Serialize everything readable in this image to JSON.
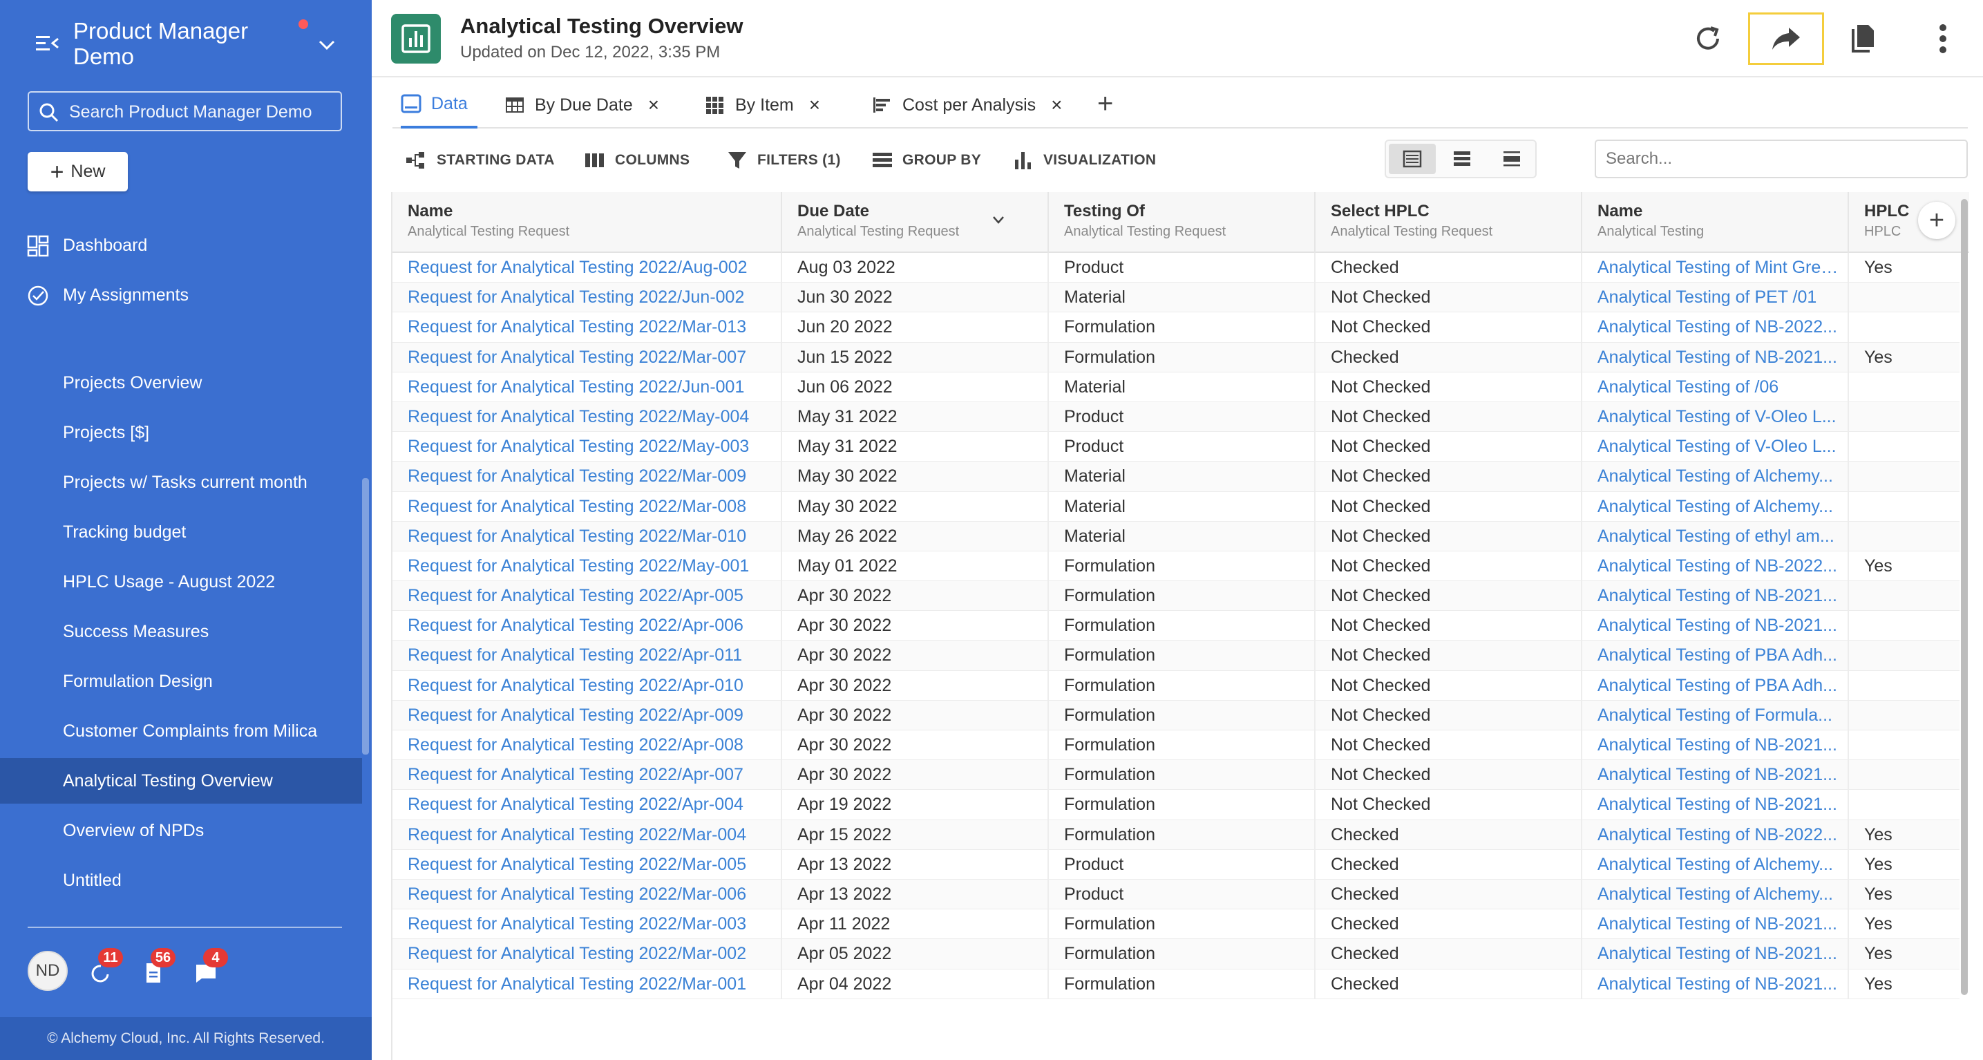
{
  "sidebar": {
    "title": "Product Manager Demo",
    "search_placeholder": "Search Product Manager Demo",
    "new_label": "New",
    "top_items": [
      {
        "label": "Dashboard",
        "icon": "dashboard-icon"
      },
      {
        "label": "My Assignments",
        "icon": "check-circle-icon"
      }
    ],
    "reports": [
      {
        "label": "Projects Overview"
      },
      {
        "label": "Projects [$]"
      },
      {
        "label": "Projects w/ Tasks current month"
      },
      {
        "label": "Tracking budget"
      },
      {
        "label": "HPLC Usage - August 2022"
      },
      {
        "label": "Success Measures"
      },
      {
        "label": "Formulation Design"
      },
      {
        "label": "Customer Complaints from Milica"
      },
      {
        "label": "Analytical Testing Overview",
        "active": true
      },
      {
        "label": "Overview of NPDs"
      },
      {
        "label": "Untitled"
      }
    ],
    "user_initials": "ND",
    "badges": {
      "activity": "11",
      "documents": "56",
      "messages": "4"
    },
    "footer": "© Alchemy Cloud, Inc. All Rights Reserved."
  },
  "header": {
    "title": "Analytical Testing Overview",
    "subtitle": "Updated on Dec 12, 2022, 3:35 PM",
    "accent_color": "#2e8b6b"
  },
  "tabs": [
    {
      "label": "Data",
      "icon": "table-icon",
      "active": true,
      "closable": false
    },
    {
      "label": "By Due Date",
      "icon": "grid-table-icon",
      "closable": true
    },
    {
      "label": "By Item",
      "icon": "pivot-icon",
      "closable": true
    },
    {
      "label": "Cost per Analysis",
      "icon": "bar-chart-horizontal-icon",
      "closable": true
    }
  ],
  "toolbar": {
    "starting_data": "STARTING DATA",
    "columns": "COLUMNS",
    "filters": "FILTERS (1)",
    "group_by": "GROUP BY",
    "visualization": "VISUALIZATION",
    "search_placeholder": "Search..."
  },
  "grid": {
    "columns": [
      {
        "title": "Name",
        "sub": "Analytical Testing Request"
      },
      {
        "title": "Due Date",
        "sub": "Analytical Testing Request"
      },
      {
        "title": "Testing Of",
        "sub": "Analytical Testing Request"
      },
      {
        "title": "Select HPLC",
        "sub": "Analytical Testing Request"
      },
      {
        "title": "Name",
        "sub": "Analytical Testing"
      },
      {
        "title": "HPLC",
        "sub": "HPLC"
      }
    ],
    "rows": [
      [
        "Request for Analytical Testing 2022/Aug-002",
        "Aug 03 2022",
        "Product",
        "Checked",
        "Analytical Testing of Mint Green...",
        "Yes"
      ],
      [
        "Request for Analytical Testing 2022/Jun-002",
        "Jun 30 2022",
        "Material",
        "Not Checked",
        "Analytical Testing of PET /01",
        ""
      ],
      [
        "Request for Analytical Testing 2022/Mar-013",
        "Jun 20 2022",
        "Formulation",
        "Not Checked",
        "Analytical Testing of NB-2022...",
        ""
      ],
      [
        "Request for Analytical Testing 2022/Mar-007",
        "Jun 15 2022",
        "Formulation",
        "Checked",
        "Analytical Testing of NB-2021...",
        "Yes"
      ],
      [
        "Request for Analytical Testing 2022/Jun-001",
        "Jun 06 2022",
        "Material",
        "Not Checked",
        "Analytical Testing of /06",
        ""
      ],
      [
        "Request for Analytical Testing 2022/May-004",
        "May 31 2022",
        "Product",
        "Not Checked",
        "Analytical Testing of V-Oleo L...",
        ""
      ],
      [
        "Request for Analytical Testing 2022/May-003",
        "May 31 2022",
        "Product",
        "Not Checked",
        "Analytical Testing of V-Oleo L...",
        ""
      ],
      [
        "Request for Analytical Testing 2022/Mar-009",
        "May 30 2022",
        "Material",
        "Not Checked",
        "Analytical Testing of Alchemy...",
        ""
      ],
      [
        "Request for Analytical Testing 2022/Mar-008",
        "May 30 2022",
        "Material",
        "Not Checked",
        "Analytical Testing of Alchemy...",
        ""
      ],
      [
        "Request for Analytical Testing 2022/Mar-010",
        "May 26 2022",
        "Material",
        "Not Checked",
        "Analytical Testing of ethyl am...",
        ""
      ],
      [
        "Request for Analytical Testing 2022/May-001",
        "May 01 2022",
        "Formulation",
        "Not Checked",
        "Analytical Testing of NB-2022...",
        "Yes"
      ],
      [
        "Request for Analytical Testing 2022/Apr-005",
        "Apr 30 2022",
        "Formulation",
        "Not Checked",
        "Analytical Testing of NB-2021...",
        ""
      ],
      [
        "Request for Analytical Testing 2022/Apr-006",
        "Apr 30 2022",
        "Formulation",
        "Not Checked",
        "Analytical Testing of NB-2021...",
        ""
      ],
      [
        "Request for Analytical Testing 2022/Apr-011",
        "Apr 30 2022",
        "Formulation",
        "Not Checked",
        "Analytical Testing of PBA Adh...",
        ""
      ],
      [
        "Request for Analytical Testing 2022/Apr-010",
        "Apr 30 2022",
        "Formulation",
        "Not Checked",
        "Analytical Testing of PBA Adh...",
        ""
      ],
      [
        "Request for Analytical Testing 2022/Apr-009",
        "Apr 30 2022",
        "Formulation",
        "Not Checked",
        "Analytical Testing of Formula...",
        ""
      ],
      [
        "Request for Analytical Testing 2022/Apr-008",
        "Apr 30 2022",
        "Formulation",
        "Not Checked",
        "Analytical Testing of NB-2021...",
        ""
      ],
      [
        "Request for Analytical Testing 2022/Apr-007",
        "Apr 30 2022",
        "Formulation",
        "Not Checked",
        "Analytical Testing of NB-2021...",
        ""
      ],
      [
        "Request for Analytical Testing 2022/Apr-004",
        "Apr 19 2022",
        "Formulation",
        "Not Checked",
        "Analytical Testing of NB-2021...",
        ""
      ],
      [
        "Request for Analytical Testing 2022/Mar-004",
        "Apr 15 2022",
        "Formulation",
        "Checked",
        "Analytical Testing of NB-2022...",
        "Yes"
      ],
      [
        "Request for Analytical Testing 2022/Mar-005",
        "Apr 13 2022",
        "Product",
        "Checked",
        "Analytical Testing of Alchemy...",
        "Yes"
      ],
      [
        "Request for Analytical Testing 2022/Mar-006",
        "Apr 13 2022",
        "Product",
        "Checked",
        "Analytical Testing of Alchemy...",
        "Yes"
      ],
      [
        "Request for Analytical Testing 2022/Mar-003",
        "Apr 11 2022",
        "Formulation",
        "Checked",
        "Analytical Testing of NB-2021...",
        "Yes"
      ],
      [
        "Request for Analytical Testing 2022/Mar-002",
        "Apr 05 2022",
        "Formulation",
        "Checked",
        "Analytical Testing of NB-2021...",
        "Yes"
      ],
      [
        "Request for Analytical Testing 2022/Mar-001",
        "Apr 04 2022",
        "Formulation",
        "Checked",
        "Analytical Testing of NB-2021...",
        "Yes"
      ]
    ]
  }
}
